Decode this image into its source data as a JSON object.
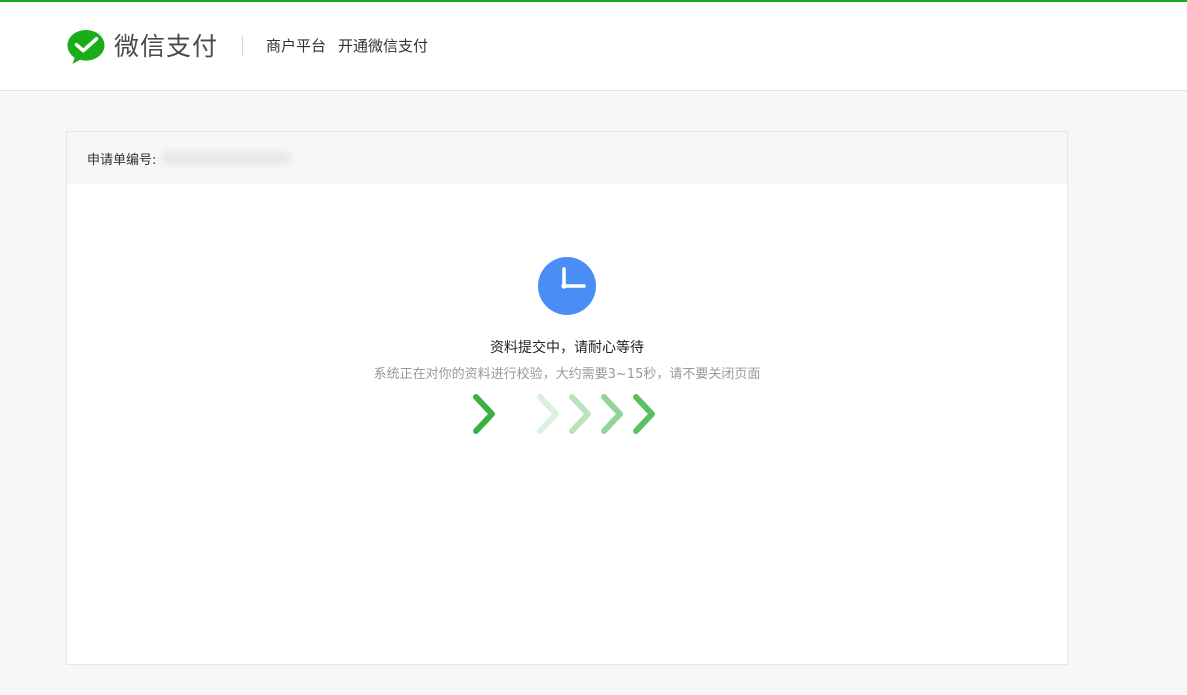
{
  "header": {
    "brand": "微信支付",
    "nav": [
      "商户平台",
      "开通微信支付"
    ]
  },
  "application": {
    "number_label": "申请单编号:"
  },
  "status": {
    "title": "资料提交中，请耐心等待",
    "description": "系统正在对你的资料进行校验，大约需要3~15秒，请不要关闭页面"
  },
  "colors": {
    "brand_green": "#1aad19",
    "clock_blue": "#4a8ef5",
    "arrow_green": "#3db042"
  },
  "icons": {
    "logo": "wechat-pay-logo-icon",
    "status": "clock-icon",
    "progress": "chevron-right-icon"
  }
}
